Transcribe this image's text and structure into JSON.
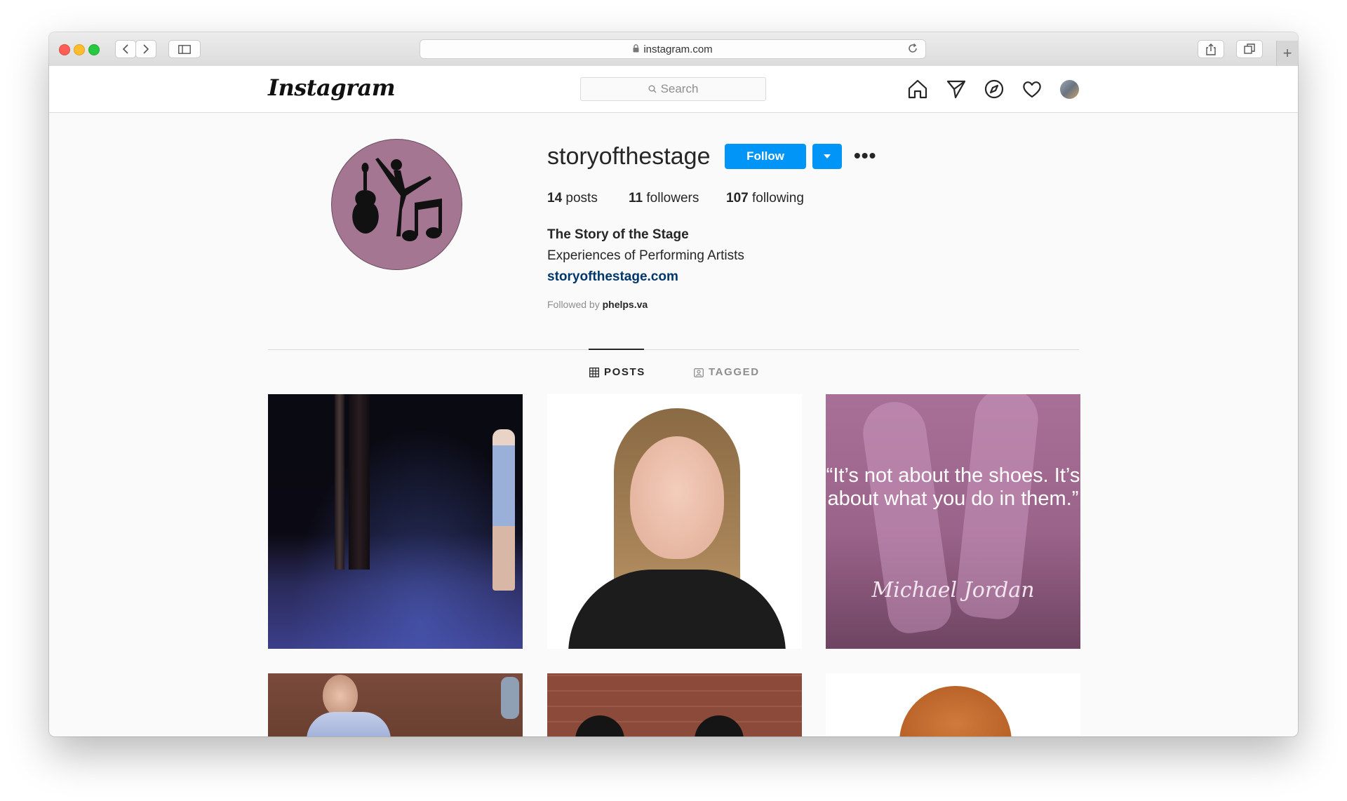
{
  "browser": {
    "url": "instagram.com"
  },
  "header": {
    "logo": "Instagram",
    "search_placeholder": "Search"
  },
  "profile": {
    "username": "storyofthestage",
    "follow_label": "Follow",
    "stats": {
      "posts_count": "14",
      "posts_label": "posts",
      "followers_count": "11",
      "followers_label": "followers",
      "following_count": "107",
      "following_label": "following"
    },
    "full_name": "The Story of the Stage",
    "bio": "Experiences of Performing Artists",
    "website": "storyofthestage.com",
    "followed_by_prefix": "Followed by",
    "followed_by_user": "phelps.va"
  },
  "tabs": [
    {
      "label": "POSTS",
      "active": true
    },
    {
      "label": "TAGGED",
      "active": false
    }
  ],
  "posts": {
    "quote_post": {
      "quote": "“It’s not about the shoes. It’s about what you do in them.”",
      "author": "Michael Jordan"
    }
  },
  "colors": {
    "accent": "#0095f6",
    "link": "#00376b",
    "profile_bg": "#a47692"
  }
}
